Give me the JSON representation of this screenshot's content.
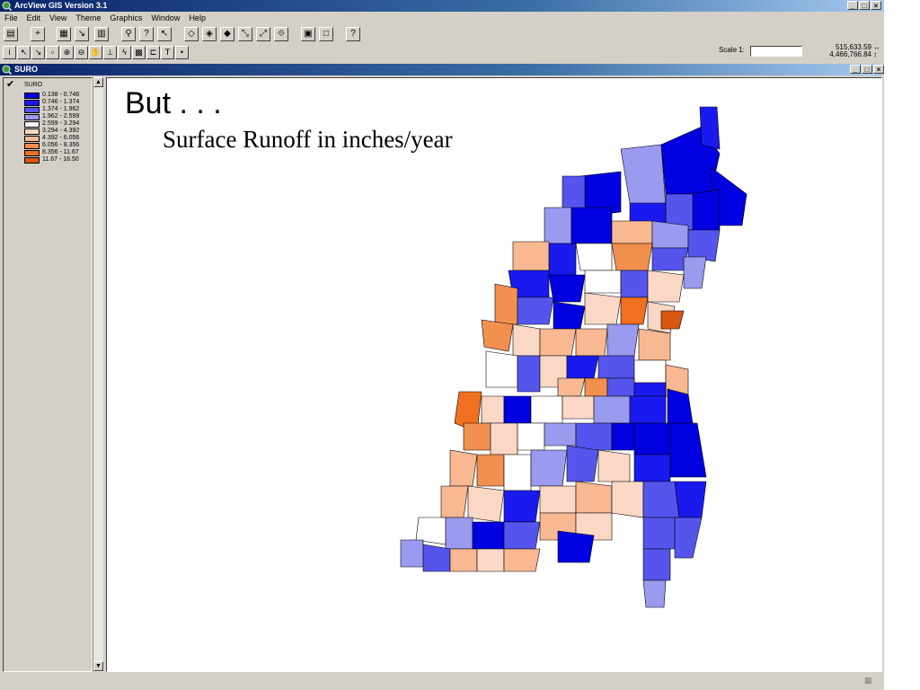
{
  "app": {
    "title": "ArcView GIS Version 3.1"
  },
  "window_buttons": {
    "minimize": "_",
    "maximize": "□",
    "close": "×"
  },
  "menu": [
    "File",
    "Edit",
    "View",
    "Theme",
    "Graphics",
    "Window",
    "Help"
  ],
  "scale": {
    "label": "Scale 1:",
    "value": ""
  },
  "coords": {
    "x": "515,633.59",
    "y": "4,466,766.84"
  },
  "doc_window": {
    "title": "SURO"
  },
  "theme": {
    "name": "SURO",
    "classes": [
      {
        "label": "0.138 - 0.746",
        "color": "#0000e0"
      },
      {
        "label": "0.746 - 1.374",
        "color": "#1a1aef"
      },
      {
        "label": "1.374 - 1.962",
        "color": "#5555ee"
      },
      {
        "label": "1.962 - 2.599",
        "color": "#9a9aee"
      },
      {
        "label": "2.599 - 3.294",
        "color": "#ffffff"
      },
      {
        "label": "3.294 - 4.392",
        "color": "#fbd8c6"
      },
      {
        "label": "4.392 - 6.056",
        "color": "#f8b892"
      },
      {
        "label": "6.056 - 8.356",
        "color": "#f29050"
      },
      {
        "label": "8.356 - 11.67",
        "color": "#f07020"
      },
      {
        "label": "11.67 - 16.50",
        "color": "#d85810"
      }
    ]
  },
  "slide": {
    "title": "But  . . .",
    "subtitle": "Surface Runoff in inches/year"
  }
}
